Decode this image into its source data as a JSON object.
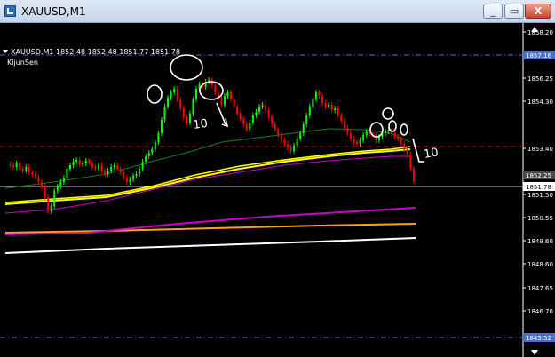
{
  "window": {
    "title": "XAUUSD,M1",
    "minimize_label": "_",
    "restore_label": "▭",
    "close_label": "X"
  },
  "chart": {
    "symbol_line": "XAUUSD,M1  1852.48 1852.48 1851.77 1851.78",
    "indicator": "KijunSen",
    "price_labels": [
      "1858.20",
      "1856.25",
      "1854.30",
      "1853.40",
      "1851.50",
      "1850.55",
      "1849.60",
      "1848.60",
      "1847.65",
      "1846.70"
    ],
    "marker_labels": {
      "upper_dashed": "1857.16",
      "current_price": "1851.78",
      "ma_label": "1852.25",
      "lower_dashed": "1845.52"
    },
    "annotations": {
      "count_left": "10",
      "count_right": "10"
    },
    "colors": {
      "background": "#000000",
      "bull_candle": "#00ff00",
      "bear_candle": "#ff0000",
      "ma_yellow": "#ffff00",
      "ma_magenta": "#cc00cc",
      "ma_orange": "#ffa500",
      "ma_white": "#ffffff",
      "kijun_green": "#1e7b1e",
      "dashed_blue": "#4a6fd0",
      "dashed_red": "#cc0000"
    }
  }
}
